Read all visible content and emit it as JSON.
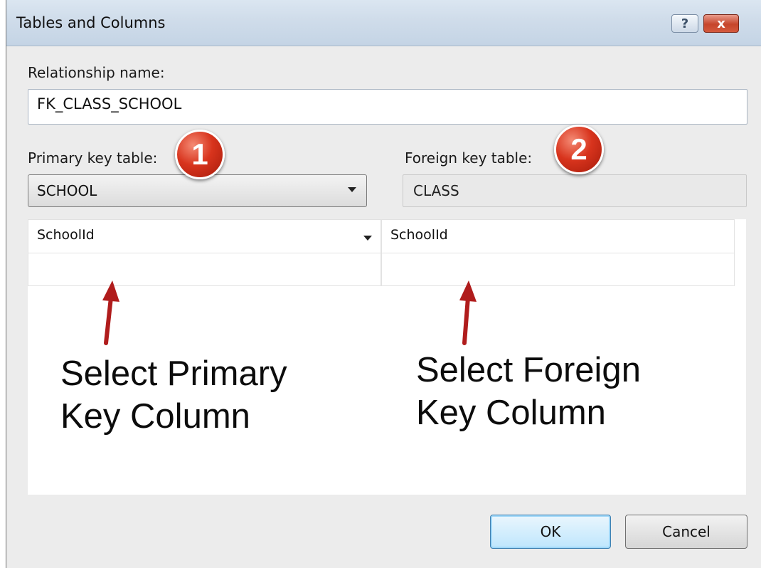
{
  "window": {
    "title": "Tables and Columns",
    "help_label": "?",
    "close_label": "x"
  },
  "relationship": {
    "label": "Relationship name:",
    "value": "FK_CLASS_SCHOOL"
  },
  "primary_key": {
    "label": "Primary key table:",
    "selected": "SCHOOL"
  },
  "foreign_key": {
    "label": "Foreign key table:",
    "value": "CLASS"
  },
  "columns": {
    "rows": [
      {
        "primary": "SchoolId",
        "foreign": "SchoolId"
      },
      {
        "primary": "",
        "foreign": ""
      }
    ]
  },
  "badges": {
    "one": "1",
    "two": "2"
  },
  "annotations": {
    "primary_line1": "Select Primary",
    "primary_line2": "Key Column",
    "foreign_line1": "Select Foreign",
    "foreign_line2": "Key Column"
  },
  "buttons": {
    "ok": "OK",
    "cancel": "Cancel"
  },
  "colors": {
    "badge": "#d8341d",
    "arrow": "#b01c1c",
    "ok_border": "#3c7fb1"
  },
  "icons": {
    "combo": "chevron-down-icon",
    "help": "help-icon",
    "close": "close-icon"
  }
}
